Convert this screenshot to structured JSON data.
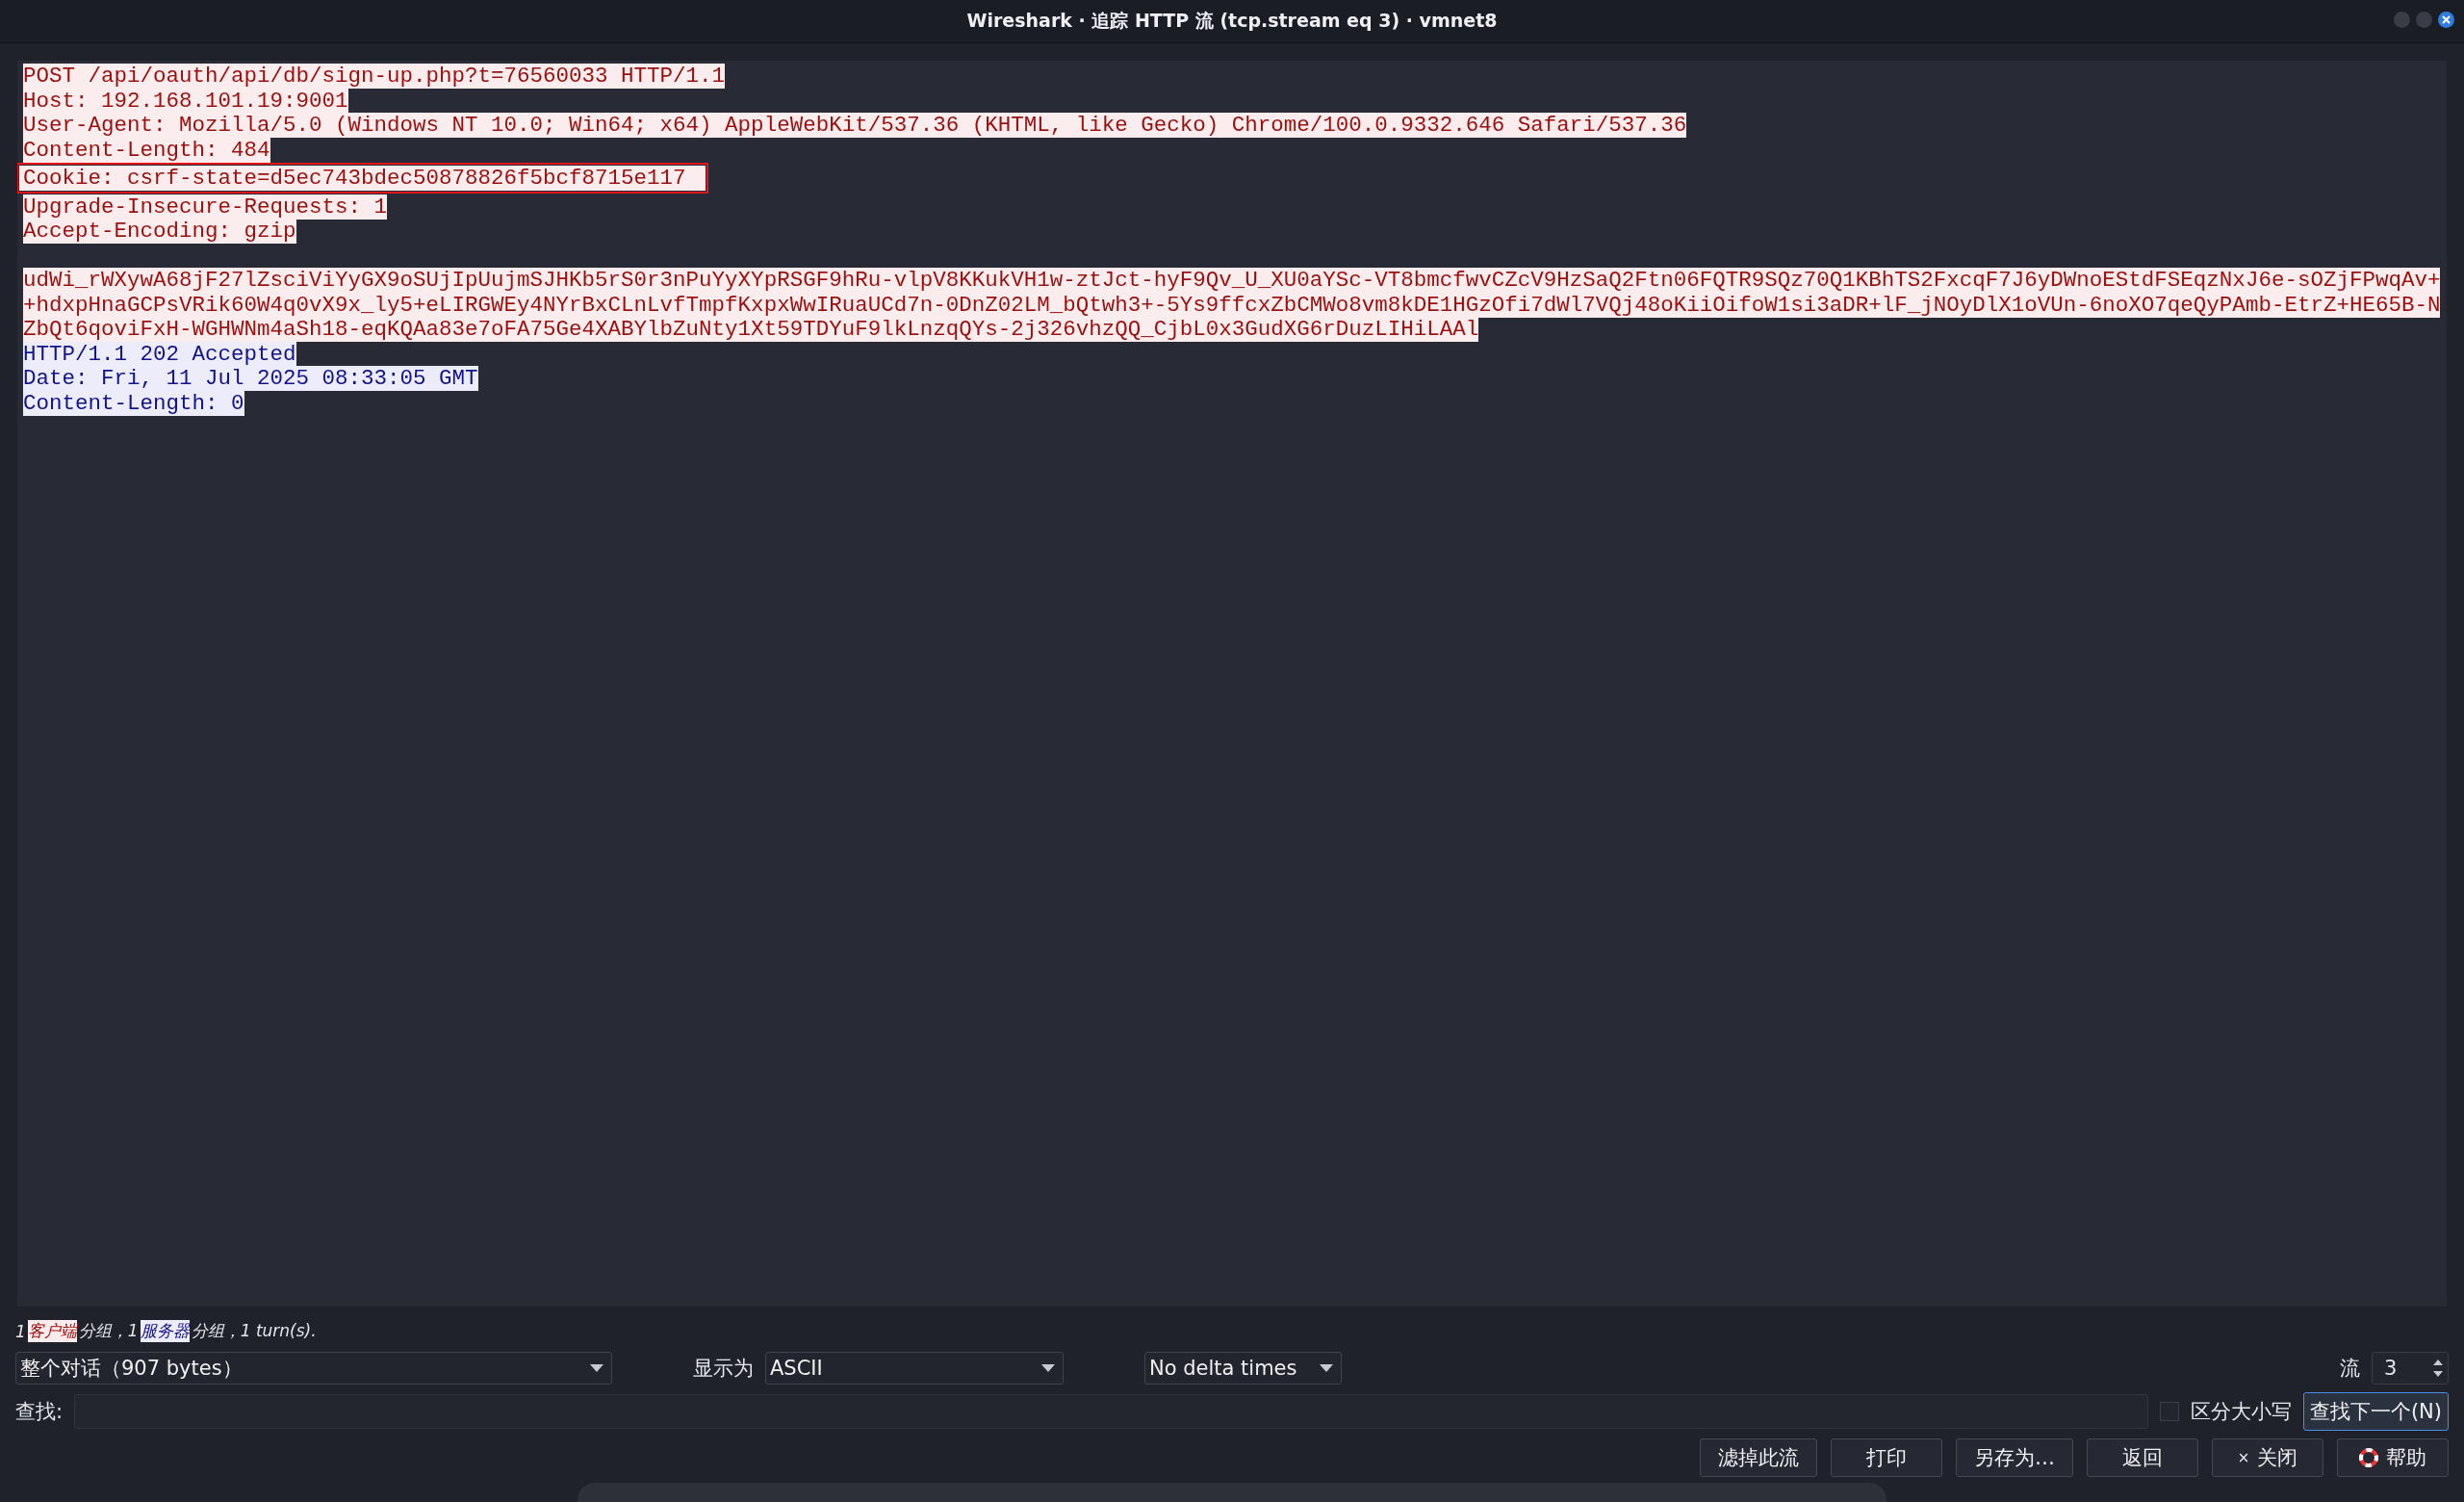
{
  "window": {
    "title": "Wireshark · 追踪 HTTP 流 (tcp.stream eq 3) · vmnet8"
  },
  "stream": {
    "segments": [
      {
        "kind": "client",
        "lines": [
          {
            "text": "POST /api/oauth/api/db/sign-up.php?t=76560033 HTTP/1.1",
            "boxed": false
          },
          {
            "text": "Host: 192.168.101.19:9001",
            "boxed": false
          },
          {
            "text": "User-Agent: Mozilla/5.0 (Windows NT 10.0; Win64; x64) AppleWebKit/537.36 (KHTML, like Gecko) Chrome/100.0.9332.646 Safari/537.36",
            "boxed": false
          },
          {
            "text": "Content-Length: 484",
            "boxed": false
          },
          {
            "text": "Cookie: csrf-state=d5ec743bdec50878826f5bcf8715e117",
            "boxed": true
          },
          {
            "text": "Upgrade-Insecure-Requests: 1",
            "boxed": false
          },
          {
            "text": "Accept-Encoding: gzip",
            "boxed": false
          }
        ]
      },
      {
        "kind": "client",
        "lines": [
          {
            "text": "udWi_rWXywA68jF27lZsciViYyGX9oSUjIpUujmSJHKb5rS0r3nPuYyXYpRSGF9hRu-vlpV8KKukVH1w-ztJct-hyF9Qv_U_XU0aYSc-VT8bmcfwvCZcV9HzSaQ2Ftn06FQTR9SQz70Q1KBhTS2FxcqF7J6yDWnoEStdFSEqzNxJ6e-sOZjFPwqAv+",
            "boxed": false
          },
          {
            "text": "+hdxpHnaGCPsVRik60W4q0vX9x_ly5+eLIRGWEy4NYrBxCLnLvfTmpfKxpxWwIRuaUCd7n-0DnZ02LM_bQtwh3+-5Ys9ffcxZbCMWo8vm8kDE1HGzOfi7dWl7VQj48oKiiOifoW1si3aDR+lF_jNOyDlX1oVUn-6noXO7qeQyPAmb-EtrZ+HE65B-N",
            "boxed": false
          },
          {
            "text": "ZbQt6qoviFxH-WGHWNm4aSh18-eqKQAa83e7oFA75Ge4XABYlbZuNty1Xt59TDYuF9lkLnzqQYs-2j326vhzQQ_CjbL0x3GudXG6rDuzLIHiLAAl",
            "boxed": false
          }
        ]
      },
      {
        "kind": "server",
        "lines": [
          {
            "text": "HTTP/1.1 202 Accepted",
            "boxed": false
          },
          {
            "text": "Date: Fri, 11 Jul 2025 08:33:05 GMT",
            "boxed": false
          },
          {
            "text": "Content-Length: 0",
            "boxed": false
          }
        ]
      }
    ]
  },
  "summary": [
    {
      "text": "1",
      "kind": "plain"
    },
    {
      "text": "客户端",
      "kind": "client"
    },
    {
      "text": "分组，1",
      "kind": "plain"
    },
    {
      "text": "服务器",
      "kind": "server"
    },
    {
      "text": "分组，1 turn(s).",
      "kind": "plain"
    }
  ],
  "conversation_select": {
    "value": "整个对话（907 bytes）"
  },
  "show_as": {
    "label": "显示为",
    "value": "ASCII"
  },
  "delta_select": {
    "value": "No delta times"
  },
  "stream_number": {
    "label": "流",
    "value": "3"
  },
  "find": {
    "label": "查找:",
    "case_sensitive": {
      "label": "区分大小写",
      "checked": false
    },
    "next_button": "查找下一个(N)"
  },
  "buttons": [
    {
      "label": "滤掉此流",
      "kind": "plain"
    },
    {
      "label": "打印",
      "kind": "plain"
    },
    {
      "label": "另存为…",
      "kind": "plain"
    },
    {
      "label": "返回",
      "kind": "plain"
    },
    {
      "label": "×",
      "kind": "close",
      "text": "关闭"
    },
    {
      "label": "帮助",
      "kind": "help"
    }
  ]
}
